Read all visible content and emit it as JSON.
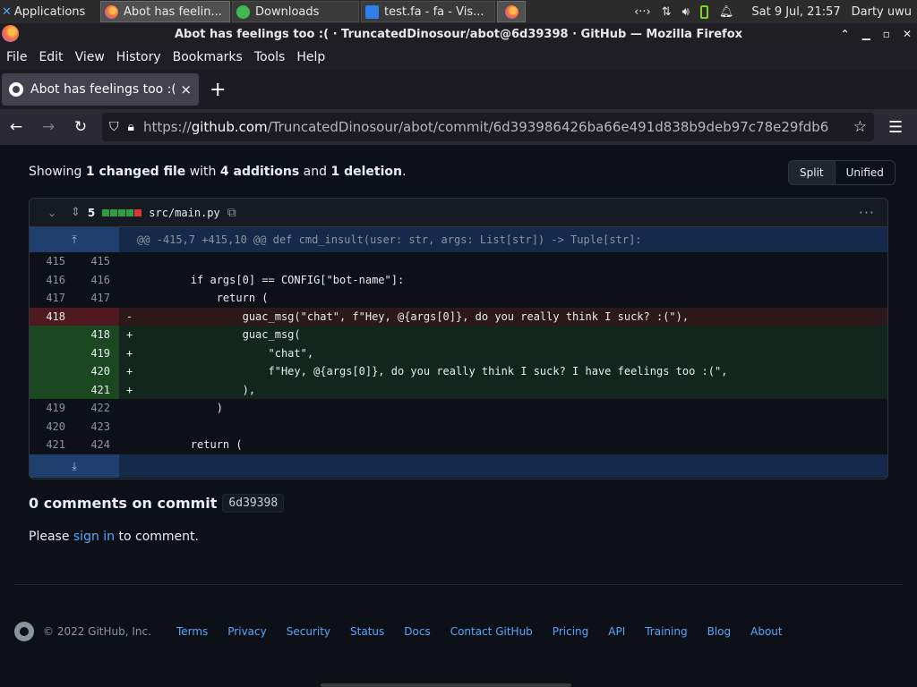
{
  "taskbar": {
    "apps_label": "Applications",
    "tasks": [
      {
        "label": "Abot has feelin...",
        "icon": "firefox-icon"
      },
      {
        "label": "Downloads",
        "icon": "download-icon"
      },
      {
        "label": "test.fa - fa - Vis...",
        "icon": "vscode-icon"
      },
      {
        "label": "",
        "icon": "firefox-icon"
      }
    ],
    "clock": "Sat  9 Jul, 21:57",
    "user": "Darty uwu"
  },
  "window": {
    "title": "Abot has feelings too :( · TruncatedDinosour/abot@6d39398 · GitHub — Mozilla Firefox"
  },
  "menu": {
    "file": "File",
    "edit": "Edit",
    "view": "View",
    "history": "History",
    "bookmarks": "Bookmarks",
    "tools": "Tools",
    "help": "Help"
  },
  "tab": {
    "title": "Abot has feelings too :( · T",
    "close": "×",
    "new_tab": "+"
  },
  "nav": {
    "url_scheme": "https://",
    "url_host": "github.com",
    "url_path": "/TruncatedDinosour/abot/commit/6d393986426ba66e491d838b9deb97c78e29fdb6"
  },
  "summary": {
    "prefix": "Showing ",
    "files": "1 changed file",
    "mid1": " with ",
    "additions": "4 additions",
    "mid2": " and ",
    "deletions": "1 deletion",
    "suffix": "."
  },
  "view_toggle": {
    "split": "Split",
    "unified": "Unified",
    "selected": "split"
  },
  "file": {
    "change_count": "5",
    "diffstat": [
      "add",
      "add",
      "add",
      "add",
      "del"
    ],
    "name": "src/main.py",
    "hunk_header": "@@ -415,7 +415,10 @@ def cmd_insult(user: str, args: List[str]) -> Tuple[str]:"
  },
  "diff_rows": [
    {
      "type": "ctx",
      "old": "415",
      "new": "415",
      "code": ""
    },
    {
      "type": "ctx",
      "old": "416",
      "new": "416",
      "code": "        if args[0] == CONFIG[\"bot-name\"]:"
    },
    {
      "type": "ctx",
      "old": "417",
      "new": "417",
      "code": "            return ("
    },
    {
      "type": "del",
      "old": "418",
      "new": "",
      "code": "                guac_msg(\"chat\", f\"Hey, @{args[0]}, do you really think I suck? :(\"),"
    },
    {
      "type": "add",
      "old": "",
      "new": "418",
      "code": "                guac_msg("
    },
    {
      "type": "add",
      "old": "",
      "new": "419",
      "code": "                    \"chat\","
    },
    {
      "type": "add",
      "old": "",
      "new": "420",
      "code": "                    f\"Hey, @{args[0]}, do you really think I suck? I have feelings too :(\","
    },
    {
      "type": "add",
      "old": "",
      "new": "421",
      "code": "                ),"
    },
    {
      "type": "ctx",
      "old": "419",
      "new": "422",
      "code": "            )"
    },
    {
      "type": "ctx",
      "old": "420",
      "new": "423",
      "code": ""
    },
    {
      "type": "ctx",
      "old": "421",
      "new": "424",
      "code": "        return ("
    }
  ],
  "comments": {
    "title": "0 comments on commit",
    "sha": "6d39398",
    "please": "Please ",
    "sign_in": "sign in",
    "to_comment": " to comment."
  },
  "footer": {
    "copyright": "© 2022 GitHub, Inc.",
    "links": [
      "Terms",
      "Privacy",
      "Security",
      "Status",
      "Docs",
      "Contact GitHub",
      "Pricing",
      "API",
      "Training",
      "Blog",
      "About"
    ]
  },
  "colors": {
    "page_bg": "#0d1117",
    "link": "#58a6ff",
    "diffstat_add": "#2ea043",
    "diffstat_del": "#da3633"
  }
}
